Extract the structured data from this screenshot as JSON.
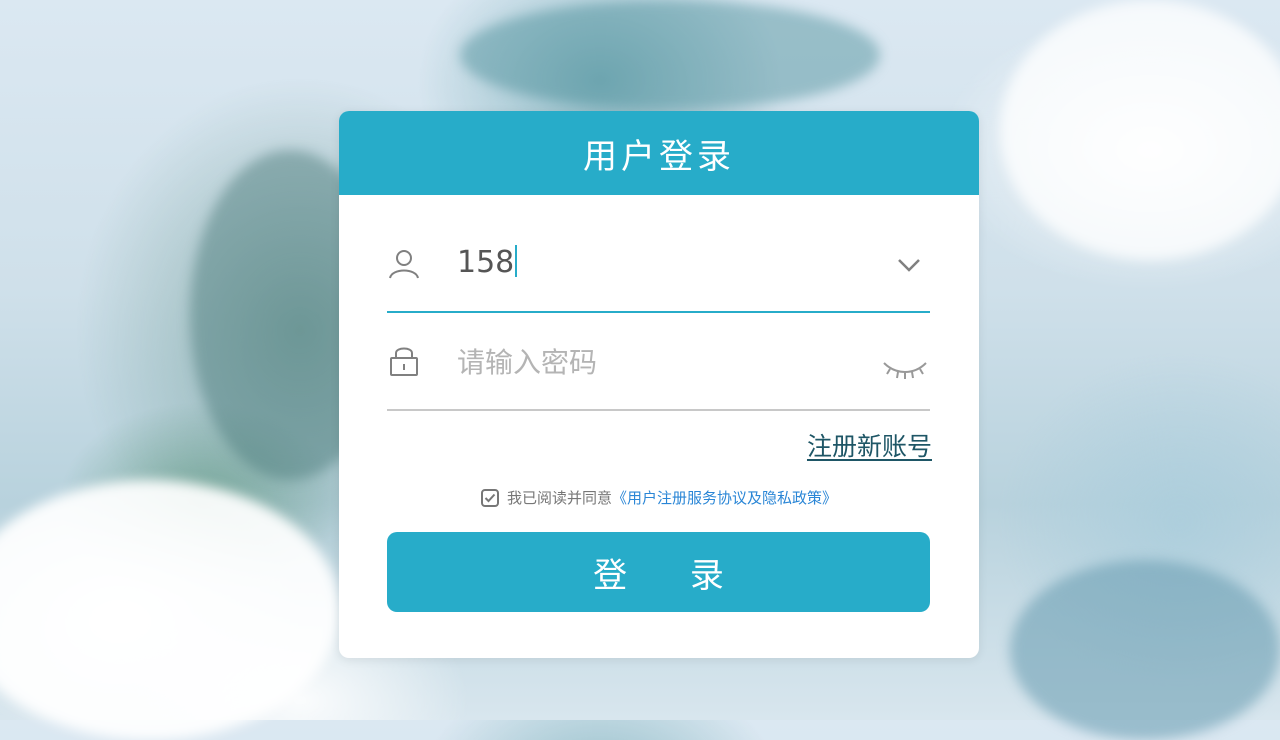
{
  "header": {
    "title": "用户登录"
  },
  "username": {
    "value": "158",
    "icon": "user-icon",
    "dropdown_icon": "chevron-down-icon"
  },
  "password": {
    "placeholder": "请输入密码",
    "icon": "lock-icon",
    "visibility_icon": "eye-closed-icon"
  },
  "register": {
    "label": "注册新账号"
  },
  "agreement": {
    "checked": true,
    "prefix": "我已阅读并同意",
    "link": "《用户注册服务协议及隐私政策》"
  },
  "login_button": {
    "label": "登 录"
  },
  "colors": {
    "accent": "#27acc9",
    "link": "#2a86d6",
    "register_link": "#1e5666"
  }
}
